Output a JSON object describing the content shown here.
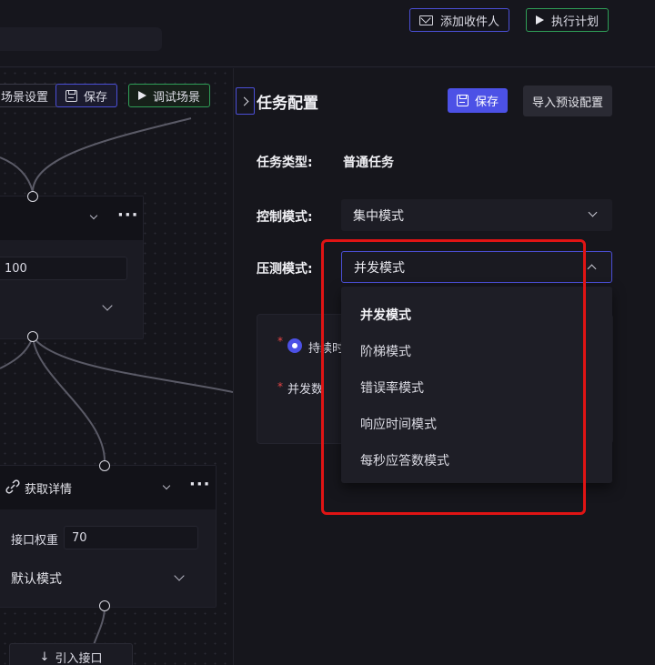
{
  "topbar": {
    "add_recipient": "添加收件人",
    "execute_plan": "执行计划"
  },
  "canvas": {
    "scene_settings": "场景设置",
    "save": "保存",
    "debug_scene": "调试场景",
    "node1": {
      "input_value": "100"
    },
    "node2": {
      "title": "获取详情",
      "weight_label": "接口权重",
      "weight_value": "70",
      "mode": "默认模式"
    },
    "import_api": "引入接口"
  },
  "panel": {
    "title": "任务配置",
    "save": "保存",
    "import_preset": "导入预设配置",
    "task_type_label": "任务类型:",
    "task_type_value": "普通任务",
    "control_mode_label": "控制模式:",
    "control_mode_value": "集中模式",
    "pressure_mode_label": "压测模式:",
    "pressure_mode_value": "并发模式",
    "duration_label": "持续时",
    "concurrency_label": "并发数"
  },
  "dropdown": {
    "options": [
      "并发模式",
      "阶梯模式",
      "错误率模式",
      "响应时间模式",
      "每秒应答数模式"
    ],
    "selected_index": 0
  },
  "colors": {
    "accent": "#4c51e6",
    "green": "#2f9e57",
    "highlight": "#e01414",
    "required": "#e84545"
  }
}
